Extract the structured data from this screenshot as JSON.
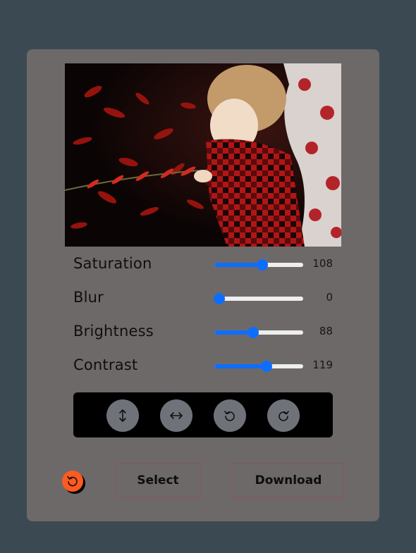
{
  "image": {
    "alt_icon": "photo-preview"
  },
  "sliders": [
    {
      "label": "Saturation",
      "value": "108",
      "fill_fraction": 0.54
    },
    {
      "label": "Blur",
      "value": "0",
      "fill_fraction": 0.0
    },
    {
      "label": "Brightness",
      "value": "88",
      "fill_fraction": 0.44
    },
    {
      "label": "Contrast",
      "value": "119",
      "fill_fraction": 0.59
    }
  ],
  "toolbar": {
    "buttons": [
      {
        "icon": "flip-vertical-icon"
      },
      {
        "icon": "flip-horizontal-icon"
      },
      {
        "icon": "rotate-left-icon"
      },
      {
        "icon": "rotate-right-icon"
      }
    ]
  },
  "actions": {
    "reset_icon": "reset-icon",
    "select_label": "Select",
    "download_label": "Download"
  },
  "colors": {
    "background": "#3b4a52",
    "card": "#6e6969",
    "accent": "#0d6efd",
    "reset": "#ff5a1f",
    "button_border": "#7c5f60"
  }
}
